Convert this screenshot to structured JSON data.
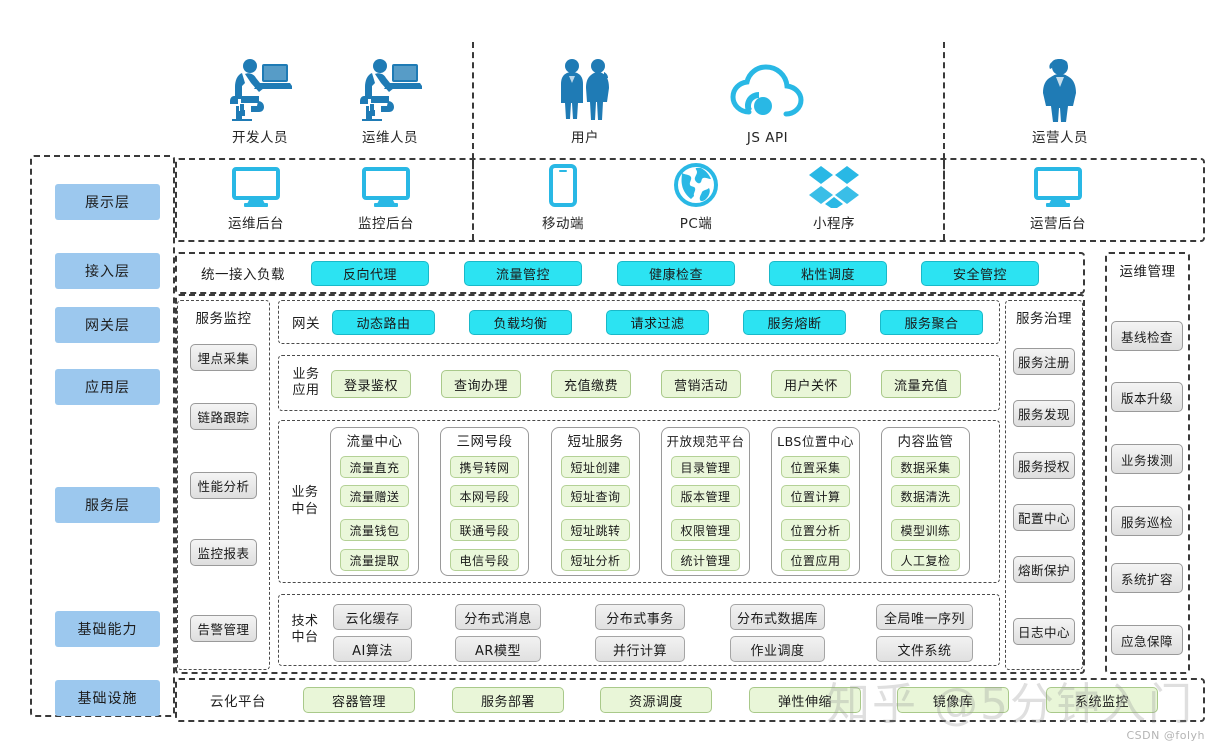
{
  "colors": {
    "layer_chip": "#9CC8EE",
    "cyan_pill": "#2CE3F2",
    "green_pill": "#E9F6D8",
    "grey_pill": "#E6E6E6",
    "icon_blue": "#1F7BB5",
    "icon_cyan": "#29B8E5",
    "dash_border": "#3a3a3a"
  },
  "layers": [
    {
      "label": "展示层"
    },
    {
      "label": "接入层"
    },
    {
      "label": "网关层"
    },
    {
      "label": "应用层"
    },
    {
      "label": "服务层"
    },
    {
      "label": "基础能力"
    },
    {
      "label": "基础设施"
    }
  ],
  "actors": [
    {
      "label": "开发人员",
      "icon": "developer-at-desk-icon"
    },
    {
      "label": "运维人员",
      "icon": "operator-at-desk-icon"
    },
    {
      "label": "用户",
      "icon": "two-people-icon"
    },
    {
      "label": "JS API",
      "icon": "cloud-api-icon"
    },
    {
      "label": "运营人员",
      "icon": "businesswoman-icon"
    }
  ],
  "presentation": {
    "items": [
      {
        "label": "运维后台",
        "icon": "monitor-icon"
      },
      {
        "label": "监控后台",
        "icon": "monitor-icon"
      },
      {
        "label": "移动端",
        "icon": "smartphone-icon"
      },
      {
        "label": "PC端",
        "icon": "globe-icon"
      },
      {
        "label": "小程序",
        "icon": "mini-program-diamond-icon"
      },
      {
        "label": "运营后台",
        "icon": "monitor-icon"
      }
    ]
  },
  "access_layer": {
    "title": "统一接入负载",
    "items": [
      "反向代理",
      "流量管控",
      "健康检查",
      "粘性调度",
      "安全管控"
    ]
  },
  "service_monitor": {
    "title": "服务监控",
    "items": [
      "埋点采集",
      "链路跟踪",
      "性能分析",
      "监控报表",
      "告警管理"
    ]
  },
  "gateway": {
    "title": "网关",
    "items": [
      "动态路由",
      "负载均衡",
      "请求过滤",
      "服务熔断",
      "服务聚合"
    ]
  },
  "business_app": {
    "title": "业务\n应用",
    "title_lines": [
      "业务",
      "应用"
    ],
    "items": [
      "登录鉴权",
      "查询办理",
      "充值缴费",
      "营销活动",
      "用户关怀",
      "流量充值"
    ]
  },
  "business_mid": {
    "title_lines": [
      "业务",
      "中台"
    ],
    "groups": [
      {
        "title": "流量中心",
        "items": [
          "流量直充",
          "流量赠送",
          "流量钱包",
          "流量提取"
        ]
      },
      {
        "title": "三网号段",
        "items": [
          "携号转网",
          "本网号段",
          "联通号段",
          "电信号段"
        ]
      },
      {
        "title": "短址服务",
        "items": [
          "短址创建",
          "短址查询",
          "短址跳转",
          "短址分析"
        ]
      },
      {
        "title": "开放规范平台",
        "items": [
          "目录管理",
          "版本管理",
          "权限管理",
          "统计管理"
        ]
      },
      {
        "title": "LBS位置中心",
        "items": [
          "位置采集",
          "位置计算",
          "位置分析",
          "位置应用"
        ]
      },
      {
        "title": "内容监管",
        "items": [
          "数据采集",
          "数据清洗",
          "模型训练",
          "人工复检"
        ]
      }
    ]
  },
  "tech_mid": {
    "title_lines": [
      "技术",
      "中台"
    ],
    "columns": [
      [
        "云化缓存",
        "AI算法"
      ],
      [
        "分布式消息",
        "AR模型"
      ],
      [
        "分布式事务",
        "并行计算"
      ],
      [
        "分布式数据库",
        "作业调度"
      ],
      [
        "全局唯一序列",
        "文件系统"
      ]
    ]
  },
  "service_governance": {
    "title": "服务治理",
    "items": [
      "服务注册",
      "服务发现",
      "服务授权",
      "配置中心",
      "熔断保护",
      "日志中心"
    ]
  },
  "ops_management": {
    "title": "运维管理",
    "items": [
      "基线检查",
      "版本升级",
      "业务拨测",
      "服务巡检",
      "系统扩容",
      "应急保障"
    ]
  },
  "cloud_platform": {
    "title": "云化平台",
    "items": [
      "容器管理",
      "服务部署",
      "资源调度",
      "弹性伸缩",
      "镜像库",
      "系统监控"
    ]
  },
  "watermarks": {
    "zhihu": "知乎 @5分钟入门",
    "csdn": "CSDN @folyh"
  }
}
